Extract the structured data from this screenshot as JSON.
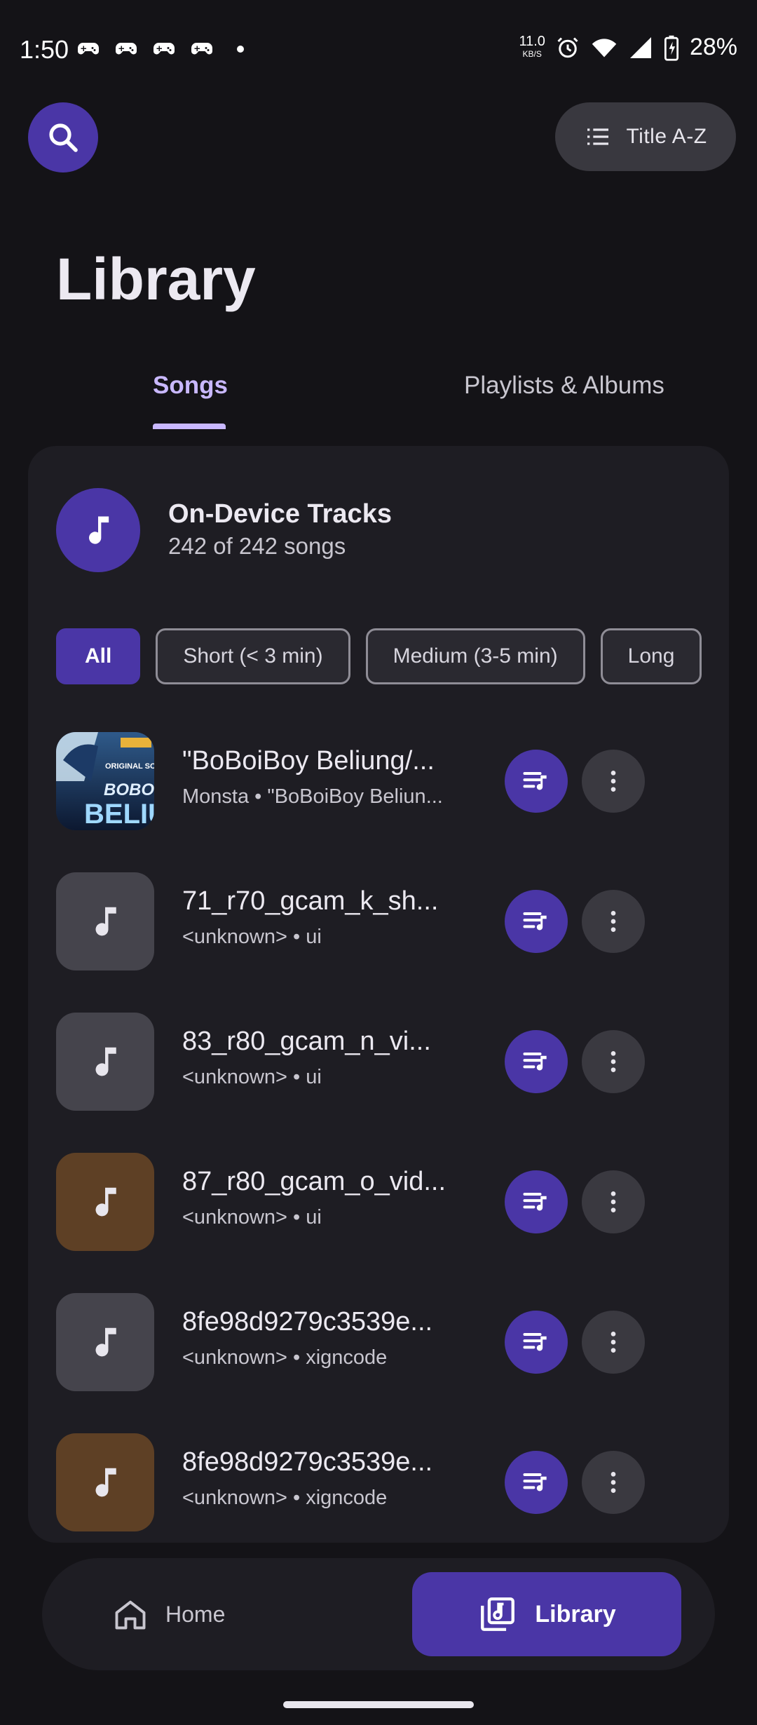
{
  "status_bar": {
    "time": "1:50",
    "net_speed": "11.0",
    "net_speed_unit": "KB/S",
    "battery": "28%"
  },
  "top_bar": {
    "sort_label": "Title A-Z"
  },
  "page": {
    "title": "Library"
  },
  "tabs": [
    {
      "label": "Songs",
      "selected": true
    },
    {
      "label": "Playlists & Albums",
      "selected": false
    }
  ],
  "card": {
    "title": "On-Device Tracks",
    "subtitle": "242 of 242 songs"
  },
  "filters": [
    {
      "label": "All",
      "selected": true
    },
    {
      "label": "Short (< 3 min)",
      "selected": false
    },
    {
      "label": "Medium (3-5 min)",
      "selected": false
    },
    {
      "label": "Long",
      "selected": false
    }
  ],
  "songs": [
    {
      "title": "\"BoBoiBoy Beliung/...",
      "subtitle": "Monsta • \"BoBoiBoy Beliun...",
      "art": "album-cover",
      "art_color": "#1b2a4a"
    },
    {
      "title": "71_r70_gcam_k_sh...",
      "subtitle": "<unknown> • ui",
      "art": "music-note-icon",
      "art_color": "#45444c"
    },
    {
      "title": "83_r80_gcam_n_vi...",
      "subtitle": "<unknown> • ui",
      "art": "music-note-icon",
      "art_color": "#45444c"
    },
    {
      "title": "87_r80_gcam_o_vid...",
      "subtitle": "<unknown> • ui",
      "art": "music-note-icon",
      "art_color": "#5e4025"
    },
    {
      "title": "8fe98d9279c3539e...",
      "subtitle": "<unknown> • xigncode",
      "art": "music-note-icon",
      "art_color": "#45444c"
    },
    {
      "title": "8fe98d9279c3539e...",
      "subtitle": "<unknown> • xigncode",
      "art": "music-note-icon",
      "art_color": "#5e4025"
    }
  ],
  "album_cover_text": {
    "line1": "ORIGINAL SOUND",
    "line2": "BOBOIB",
    "line3": "BELIU"
  },
  "bottom_nav": {
    "home_label": "Home",
    "library_label": "Library"
  },
  "colors": {
    "accent": "#4a36a6",
    "accent_light": "#c9b8ff",
    "background": "#141317",
    "surface": "#1e1d23"
  }
}
